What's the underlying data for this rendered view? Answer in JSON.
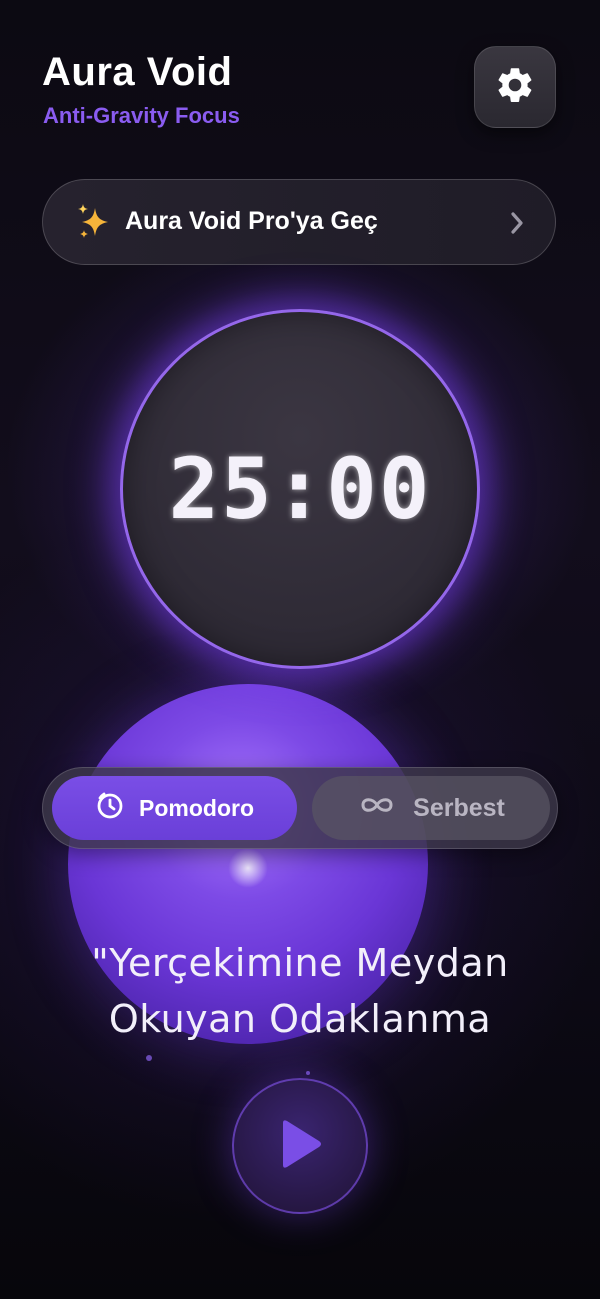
{
  "header": {
    "title": "Aura Void",
    "subtitle": "Anti-Gravity Focus",
    "settings_icon": "gear-icon"
  },
  "pro_banner": {
    "label": "Aura Void Pro'ya Geç",
    "icon": "sparkle-icon",
    "chevron_icon": "chevron-right-icon"
  },
  "timer": {
    "display": "25:00"
  },
  "modes": {
    "selected": "Pomodoro",
    "items": [
      {
        "label": "Pomodoro",
        "icon": "timer-icon"
      },
      {
        "label": "Serbest",
        "icon": "infinity-icon"
      }
    ]
  },
  "quote": {
    "line1": "\"Yerçekimine Meydan",
    "line2": "Okuyan Odaklanma"
  },
  "controls": {
    "play_icon": "play-icon"
  },
  "colors": {
    "accent": "#7a4ee6",
    "subtitle": "#8a5cf0",
    "background": "#0b0812",
    "sparkle": "#f5b43a"
  }
}
